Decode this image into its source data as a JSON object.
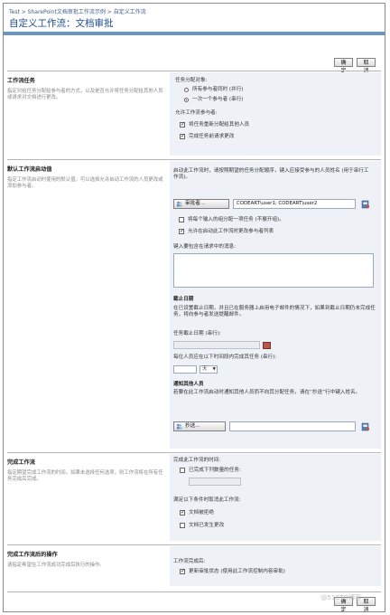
{
  "header": {
    "breadcrumb": "Test > SharePoint文档审批工作流示例 > 自定义工作流",
    "title": "自定义工作流：文档审批"
  },
  "actions": {
    "ok": "确定",
    "cancel": "取消"
  },
  "sections": {
    "participants": {
      "title": "工作流任务",
      "desc": "指定对给任务分配给参与者的方式，以及是否允许将任务分配给其他人员或请求对文档进行更改。",
      "assign_label": "任务分配对象:",
      "radio_all": "所有参与者同时 (并行)",
      "radio_one": "一次一个参与者 (串行)",
      "allow_label": "允许工作流参与者:",
      "chk_reassign": "将任务重新分配给其他人员",
      "chk_request_change": "完成任务前请求更改"
    },
    "defaults": {
      "title": "默认工作流启动值",
      "desc": "指定工作流启动时使用的默认值。可以选择允许启动工作流的人员更改或添加参与者。",
      "approvers_intro": "启动此工作流时，请按照期望的任务分配顺序，键入应接受参与的人员姓名 (用于串行工作流)。",
      "approvers_btn": "审批者...",
      "approvers_value": "CODEART\\user1; CODEART\\user2",
      "chk_group": "将每个输入的组分配一项任务 (不展开组)。",
      "chk_allow_change": "允许在启动此工作流时更改参与者列表",
      "message_label": "键入要包含在请求中的消息:",
      "due_title": "截止日期",
      "due_desc": "在已设置截止日期，并且已在服务器上启用电子邮件的情况下，如果到截止日期仍未完成任务，将向参与者发送提醒邮件。",
      "due_date_label": "任务截止日期 (串行):",
      "duration_label": "每位人员应在以下时间段内完成其任务 (串行):",
      "duration_unit": "天",
      "notify_title": "通知其他人员",
      "notify_desc": "若要在此工作流启动时通知其他人员而不向其分配任务，请在“抄送”行中键入姓名。",
      "cc_btn": "抄送..."
    },
    "complete": {
      "title": "完成工作流",
      "desc": "指定期望完成工作流的时间。如果未选择任何选项，则工作流将在所有任务完成后完成。",
      "complete_when_label": "完成此工作流的时间:",
      "chk_count": "已完成下列数量的任务:",
      "cancel_when_label": "满足以下条件时取消此工作流:",
      "chk_rejected": "文档被拒绝",
      "chk_changed": "文档已发生更改"
    },
    "post": {
      "title": "完成工作流后的操作",
      "desc": "请指定希望在工作流成功完成后执行的操作。",
      "after_label": "工作流完成后:",
      "chk_update_status": "更新审批状态 (使用此工作流控制内容审批)"
    }
  },
  "watermark": "@51CTO博客",
  "colors": {
    "header_bar": "#6b95c5",
    "panel_bg": "#eef2f7",
    "title": "#1f4e8c"
  }
}
